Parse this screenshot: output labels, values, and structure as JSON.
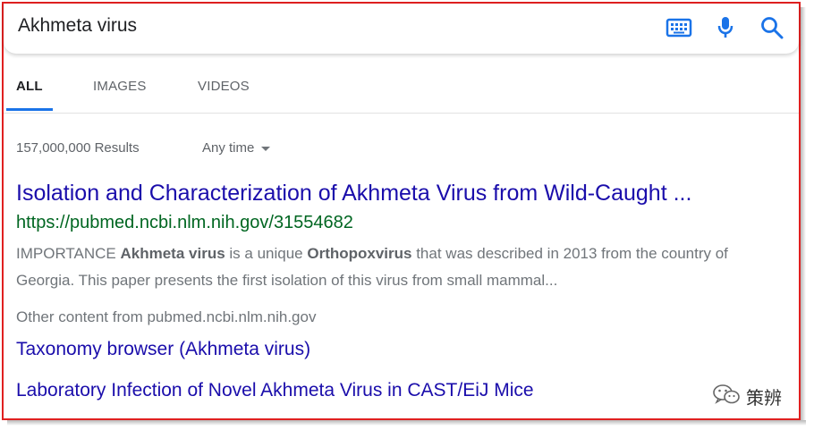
{
  "search": {
    "query": "Akhmeta virus",
    "icons": [
      "keyboard-icon",
      "microphone-icon",
      "search-icon"
    ]
  },
  "tabs": [
    {
      "label": "ALL",
      "active": true
    },
    {
      "label": "IMAGES",
      "active": false
    },
    {
      "label": "VIDEOS",
      "active": false
    }
  ],
  "stats": {
    "results_count": "157,000,000 Results",
    "time_filter": "Any time"
  },
  "result": {
    "title": "Isolation and Characterization of Akhmeta Virus from Wild-Caught ...",
    "url": "https://pubmed.ncbi.nlm.nih.gov/31554682",
    "snippet_1": "IMPORTANCE ",
    "snippet_bold_1": "Akhmeta virus",
    "snippet_2": " is a unique ",
    "snippet_bold_2": "Orthopoxvirus",
    "snippet_3": " that was described in 2013 from the country of Georgia. This paper presents the first isolation of this virus from small mammal..."
  },
  "more": {
    "other_content": "Other content from pubmed.ncbi.nlm.nih.gov",
    "links": [
      "Taxonomy browser (Akhmeta virus)",
      "Laboratory Infection of Novel Akhmeta Virus in CAST/EiJ Mice"
    ]
  },
  "watermark": {
    "text": "策辨",
    "icon": "wechat-icon"
  },
  "colors": {
    "accent": "#1a73e8",
    "icon": "#1a73e8",
    "link": "#1a0dab",
    "url": "#006621",
    "frame": "#e02020"
  }
}
